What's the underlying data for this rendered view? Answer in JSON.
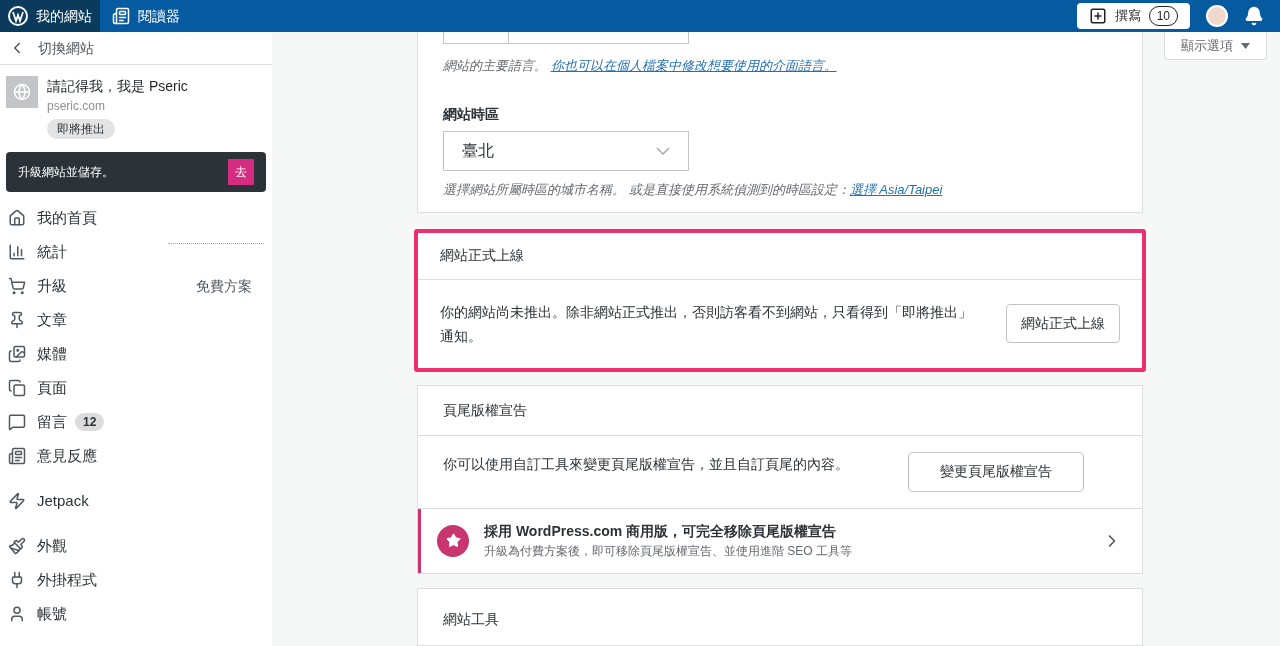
{
  "topbar": {
    "my_site": "我的網站",
    "reader": "閱讀器",
    "write": "撰寫",
    "write_count": "10"
  },
  "sidebar": {
    "back": "切換網站",
    "site_title": "請記得我，我是 Pseric",
    "site_url": "pseric.com",
    "site_badge": "即將推出",
    "upgrade_text": "升級網站並儲存。",
    "upgrade_button": "去",
    "items": [
      {
        "label": "我的首頁"
      },
      {
        "label": "統計"
      },
      {
        "label": "升級",
        "note": "免費方案"
      },
      {
        "label": "文章"
      },
      {
        "label": "媒體"
      },
      {
        "label": "頁面"
      },
      {
        "label": "留言",
        "count": "12"
      },
      {
        "label": "意見反應"
      },
      {
        "label": "Jetpack"
      },
      {
        "label": "外觀"
      },
      {
        "label": "外掛程式"
      },
      {
        "label": "帳號"
      }
    ]
  },
  "display_options": "顯示選項",
  "language_card": {
    "hint": "網站的主要語言。",
    "hint_link": "你也可以在個人檔案中修改想要使用的介面語言。",
    "timezone_label": "網站時區",
    "timezone_value": "臺北",
    "timezone_hint": "選擇網站所屬時區的城市名稱。 或是直接使用系統偵測到的時區設定：",
    "timezone_link": "選擇 Asia/Taipei"
  },
  "launch_card": {
    "highlighted": true,
    "title": "網站正式上線",
    "text": "你的網站尚未推出。除非網站正式推出，否則訪客看不到網站，只看得到「即將推出」通知。",
    "button": "網站正式上線"
  },
  "footer_card": {
    "title": "頁尾版權宣告",
    "text": "你可以使用自訂工具來變更頁尾版權宣告，並且自訂頁尾的內容。",
    "button": "變更頁尾版權宣告",
    "promo_title": "採用 WordPress.com 商用版，可完全移除頁尾版權宣告",
    "promo_text": "升級為付費方案後，即可移除頁尾版權宣告、並使用進階 SEO 工具等"
  },
  "tools_card": {
    "title": "網站工具"
  }
}
